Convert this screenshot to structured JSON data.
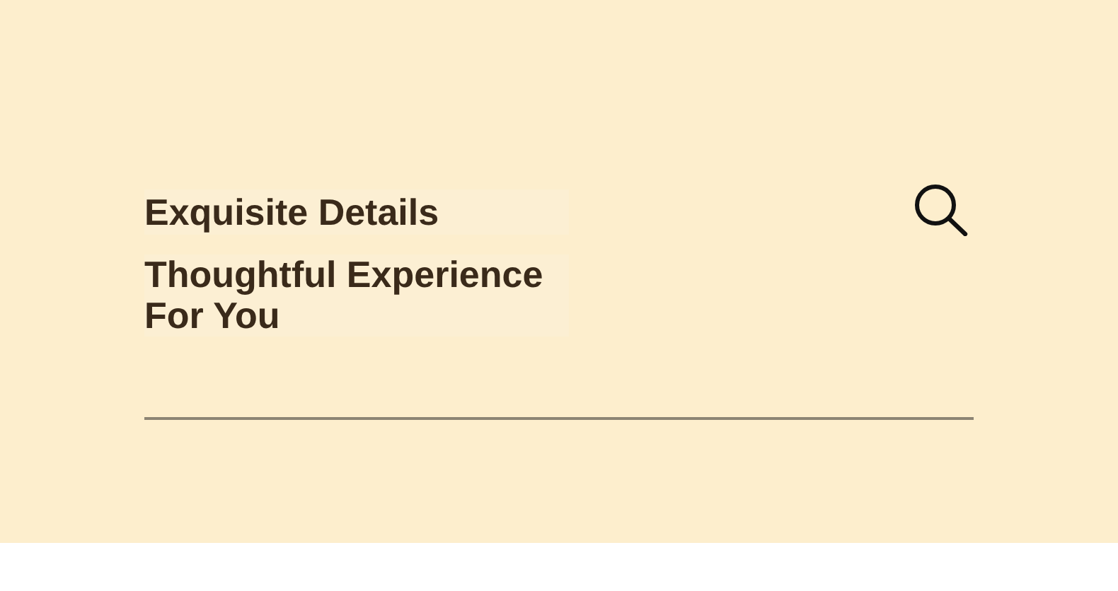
{
  "heading": "Exquisite Details",
  "subheading": "Thoughtful Experience For You"
}
